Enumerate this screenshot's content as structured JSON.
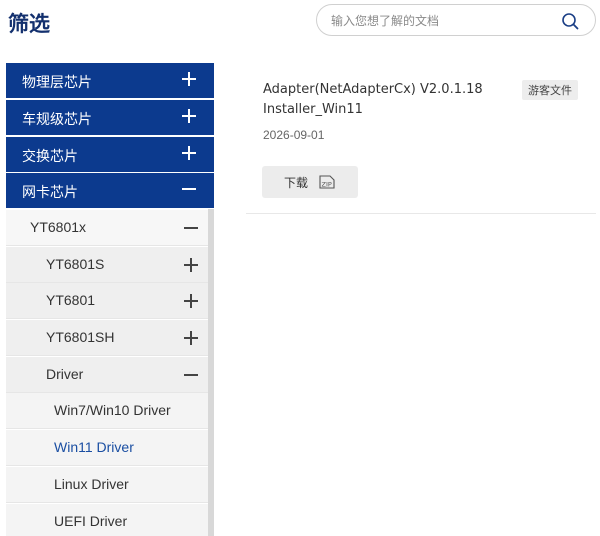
{
  "header": {
    "title": "筛选"
  },
  "search": {
    "placeholder": "输入您想了解的文档"
  },
  "sidebar": {
    "categories": [
      {
        "label": "物理层芯片",
        "state": "collapsed"
      },
      {
        "label": "车规级芯片",
        "state": "collapsed"
      },
      {
        "label": "交换芯片",
        "state": "collapsed"
      },
      {
        "label": "网卡芯片",
        "state": "expanded"
      }
    ],
    "tree": [
      {
        "label": "YT6801x",
        "level": 1,
        "state": "expanded"
      },
      {
        "label": "YT6801S",
        "level": 2,
        "state": "collapsed"
      },
      {
        "label": "YT6801",
        "level": 2,
        "state": "collapsed"
      },
      {
        "label": "YT6801SH",
        "level": 2,
        "state": "collapsed"
      },
      {
        "label": "Driver",
        "level": 2,
        "state": "expanded"
      },
      {
        "label": "Win7/Win10 Driver",
        "level": 3
      },
      {
        "label": "Win11 Driver",
        "level": 3,
        "selected": true
      },
      {
        "label": "Linux Driver",
        "level": 3
      },
      {
        "label": "UEFI Driver",
        "level": 3
      }
    ]
  },
  "document": {
    "title": "Adapter(NetAdapterCx) V2.0.1.18 Installer_Win11",
    "badge": "游客文件",
    "date": "2026-09-01",
    "download_label": "下载",
    "file_type_icon": "zip-file-icon"
  },
  "colors": {
    "brand": "#0c3a8e",
    "selected_text": "#1a4ea2",
    "title": "#13306e"
  }
}
